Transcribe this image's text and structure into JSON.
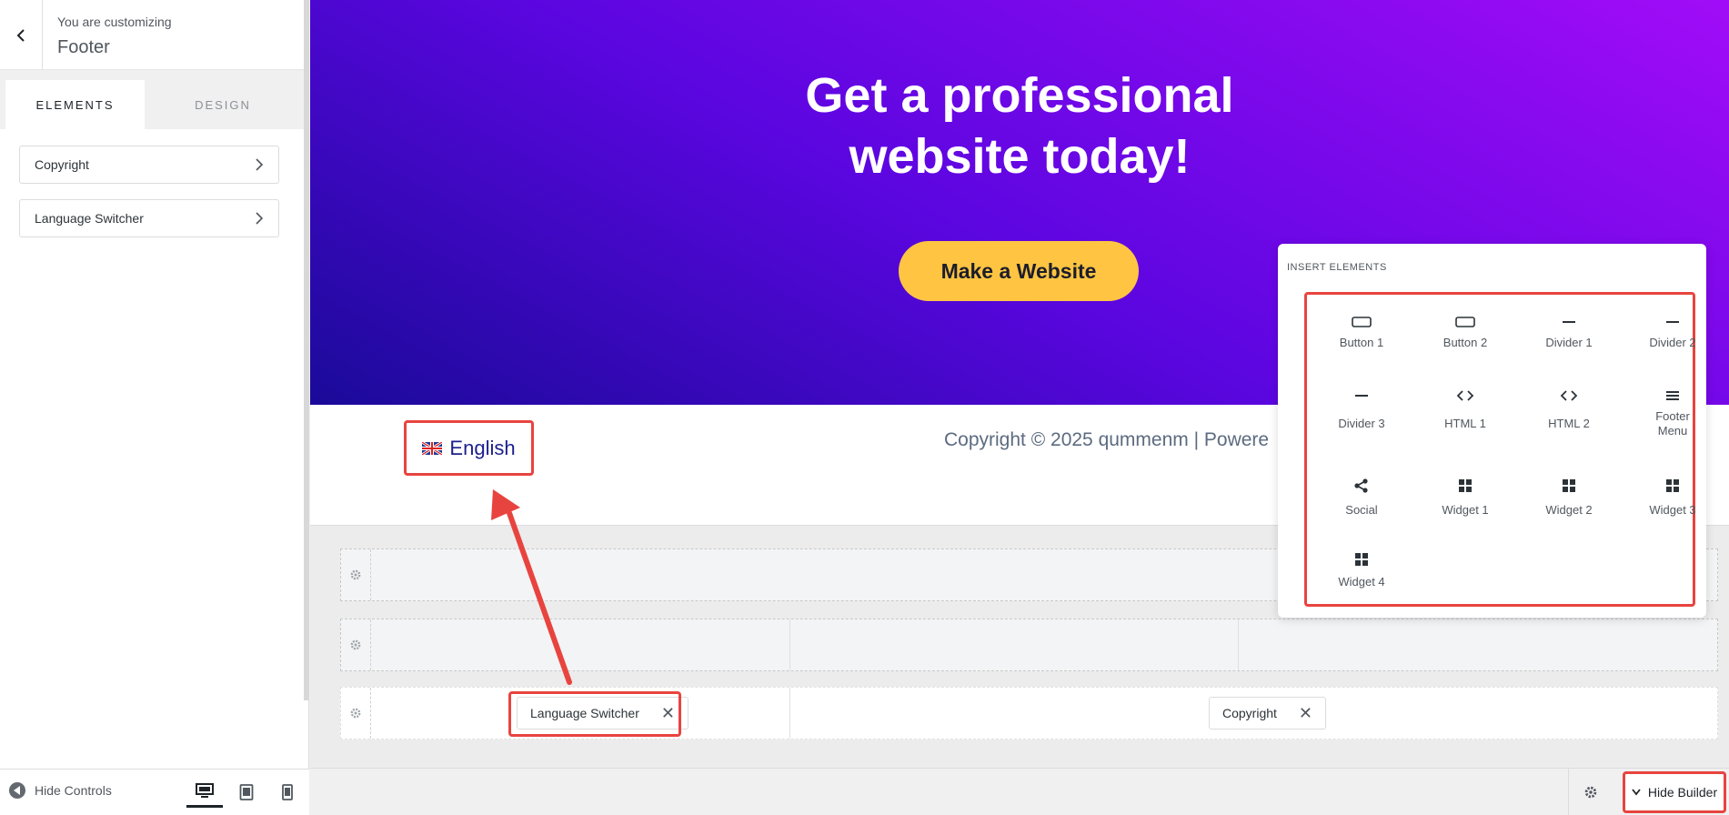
{
  "sidebar": {
    "subtitle": "You are customizing",
    "title": "Footer",
    "tabs": [
      {
        "label": "ELEMENTS"
      },
      {
        "label": "DESIGN"
      }
    ],
    "items": [
      {
        "label": "Copyright"
      },
      {
        "label": "Language Switcher"
      }
    ],
    "footer": {
      "hide_controls_label": "Hide Controls"
    }
  },
  "hero": {
    "title_line1": "Get a professional",
    "title_line2": "website today!",
    "cta_label": "Make a Website"
  },
  "footer_preview": {
    "language": "English",
    "copyright": "Copyright © 2025 qummenm | Powere"
  },
  "insert_panel": {
    "title": "INSERT ELEMENTS",
    "elements": [
      {
        "label": "Button 1",
        "icon": "button-icon"
      },
      {
        "label": "Button 2",
        "icon": "button-icon"
      },
      {
        "label": "Divider 1",
        "icon": "divider-icon"
      },
      {
        "label": "Divider 2",
        "icon": "divider-icon"
      },
      {
        "label": "Divider 3",
        "icon": "divider-icon"
      },
      {
        "label": "HTML 1",
        "icon": "code-icon"
      },
      {
        "label": "HTML 2",
        "icon": "code-icon"
      },
      {
        "label": "Footer Menu",
        "icon": "menu-icon"
      },
      {
        "label": "Social",
        "icon": "share-icon"
      },
      {
        "label": "Widget 1",
        "icon": "widget-icon"
      },
      {
        "label": "Widget 2",
        "icon": "widget-icon"
      },
      {
        "label": "Widget 3",
        "icon": "widget-icon"
      },
      {
        "label": "Widget 4",
        "icon": "widget-icon"
      }
    ]
  },
  "builder": {
    "chips": [
      {
        "label": "Language Switcher"
      },
      {
        "label": "Copyright"
      }
    ],
    "hide_builder_label": "Hide Builder"
  },
  "colors": {
    "highlight": "#e8443f",
    "cta": "#ffc542",
    "hero_start": "#1a0a99",
    "hero_end": "#a10cf7"
  }
}
